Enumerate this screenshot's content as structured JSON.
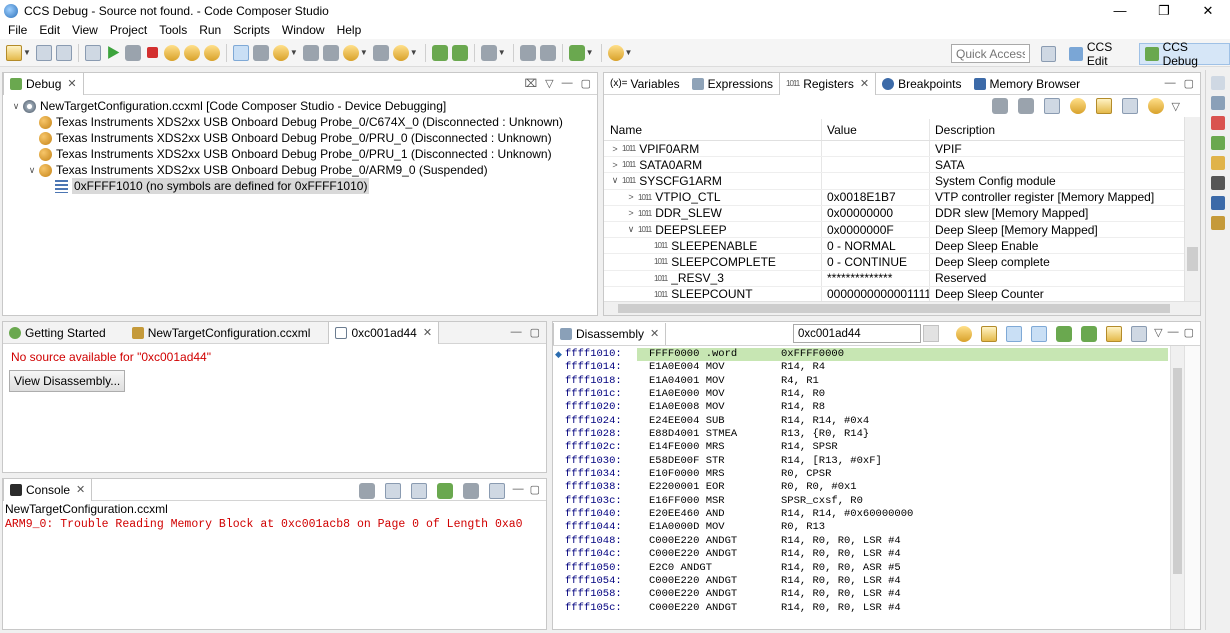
{
  "window": {
    "title": "CCS Debug - Source not found. - Code Composer Studio",
    "minimize": "—",
    "maximize": "❐",
    "close": "✕"
  },
  "menu": [
    "File",
    "Edit",
    "View",
    "Project",
    "Tools",
    "Run",
    "Scripts",
    "Window",
    "Help"
  ],
  "toolbar": {
    "quick_access_placeholder": "Quick Access",
    "perspectives": [
      "CCS Edit",
      "CCS Debug"
    ]
  },
  "debug_view": {
    "tab": "Debug",
    "tree": [
      {
        "level": 0,
        "toggle": "∨",
        "icon": "cfg",
        "text": "NewTargetConfiguration.ccxml [Code Composer Studio - Device Debugging]"
      },
      {
        "level": 1,
        "toggle": "",
        "icon": "probe",
        "text": "Texas Instruments XDS2xx USB Onboard Debug Probe_0/C674X_0 (Disconnected : Unknown)"
      },
      {
        "level": 1,
        "toggle": "",
        "icon": "probe",
        "text": "Texas Instruments XDS2xx USB Onboard Debug Probe_0/PRU_0 (Disconnected : Unknown)"
      },
      {
        "level": 1,
        "toggle": "",
        "icon": "probe",
        "text": "Texas Instruments XDS2xx USB Onboard Debug Probe_0/PRU_1 (Disconnected : Unknown)"
      },
      {
        "level": 1,
        "toggle": "∨",
        "icon": "probe",
        "text": "Texas Instruments XDS2xx USB Onboard Debug Probe_0/ARM9_0 (Suspended)"
      },
      {
        "level": 2,
        "toggle": "",
        "icon": "stack",
        "text": "0xFFFF1010  (no symbols are defined for 0xFFFF1010)",
        "selected": true
      }
    ]
  },
  "registers_view": {
    "tabs": [
      "Variables",
      "Expressions",
      "Registers",
      "Breakpoints",
      "Memory Browser"
    ],
    "columns": [
      "Name",
      "Value",
      "Description"
    ],
    "rows": [
      {
        "level": 0,
        "toggle": ">",
        "name": "VPIF0ARM",
        "value": "",
        "desc": "VPIF"
      },
      {
        "level": 0,
        "toggle": ">",
        "name": "SATA0ARM",
        "value": "",
        "desc": "SATA"
      },
      {
        "level": 0,
        "toggle": "∨",
        "name": "SYSCFG1ARM",
        "value": "",
        "desc": "System Config module"
      },
      {
        "level": 1,
        "toggle": ">",
        "name": "VTPIO_CTL",
        "value": "0x0018E1B7",
        "desc": "VTP controller register [Memory Mapped]"
      },
      {
        "level": 1,
        "toggle": ">",
        "name": "DDR_SLEW",
        "value": "0x00000000",
        "desc": "DDR slew [Memory Mapped]"
      },
      {
        "level": 1,
        "toggle": "∨",
        "name": "DEEPSLEEP",
        "value": "0x0000000F",
        "desc": "Deep Sleep [Memory Mapped]"
      },
      {
        "level": 2,
        "toggle": "",
        "name": "SLEEPENABLE",
        "value": "0 - NORMAL",
        "desc": "Deep Sleep Enable"
      },
      {
        "level": 2,
        "toggle": "",
        "name": "SLEEPCOMPLETE",
        "value": "0 - CONTINUE",
        "desc": "Deep Sleep complete"
      },
      {
        "level": 2,
        "toggle": "",
        "name": "_RESV_3",
        "value": "**************",
        "desc": "Reserved"
      },
      {
        "level": 2,
        "toggle": "",
        "name": "SLEEPCOUNT",
        "value": "0000000000001111",
        "desc": "Deep Sleep Counter"
      }
    ]
  },
  "editor": {
    "tabs": [
      "Getting Started",
      "NewTargetConfiguration.ccxml",
      "0xc001ad44"
    ],
    "message": "No source available for \"0xc001ad44\"",
    "button": "View Disassembly..."
  },
  "console": {
    "tab": "Console",
    "subtitle": "NewTargetConfiguration.ccxml",
    "error": "ARM9_0: Trouble Reading Memory Block at 0xc001acb8 on Page 0 of Length 0xa0"
  },
  "disassembly": {
    "tab": "Disassembly",
    "address_input": "0xc001ad44",
    "rows": [
      {
        "addr": "ffff1010:",
        "op": "FFFF0000 .word",
        "arg": "0xFFFF0000",
        "current": true
      },
      {
        "addr": "ffff1014:",
        "op": "E1A0E004 MOV",
        "arg": "R14, R4"
      },
      {
        "addr": "ffff1018:",
        "op": "E1A04001 MOV",
        "arg": "R4, R1"
      },
      {
        "addr": "ffff101c:",
        "op": "E1A0E000 MOV",
        "arg": "R14, R0"
      },
      {
        "addr": "ffff1020:",
        "op": "E1A0E008 MOV",
        "arg": "R14, R8"
      },
      {
        "addr": "ffff1024:",
        "op": "E24EE004 SUB",
        "arg": "R14, R14, #0x4"
      },
      {
        "addr": "ffff1028:",
        "op": "E88D4001 STMEA",
        "arg": "R13, {R0, R14}"
      },
      {
        "addr": "ffff102c:",
        "op": "E14FE000 MRS",
        "arg": "R14, SPSR"
      },
      {
        "addr": "ffff1030:",
        "op": "E58DE00F STR",
        "arg": "R14, [R13, #0xF]"
      },
      {
        "addr": "ffff1034:",
        "op": "E10F0000 MRS",
        "arg": "R0, CPSR"
      },
      {
        "addr": "ffff1038:",
        "op": "E2200001 EOR",
        "arg": "R0, R0, #0x1"
      },
      {
        "addr": "ffff103c:",
        "op": "E16FF000 MSR",
        "arg": "SPSR_cxsf, R0"
      },
      {
        "addr": "ffff1040:",
        "op": "E20EE460 AND",
        "arg": "R14, R14, #0x60000000"
      },
      {
        "addr": "ffff1044:",
        "op": "E1A0000D MOV",
        "arg": "R0, R13"
      },
      {
        "addr": "ffff1048:",
        "op": "C000E220 ANDGT",
        "arg": "R14, R0, R0, LSR #4"
      },
      {
        "addr": "ffff104c:",
        "op": "C000E220 ANDGT",
        "arg": "R14, R0, R0, LSR #4"
      },
      {
        "addr": "ffff1050:",
        "op": "E2C0 ANDGT",
        "arg": "R14, R0, R0, ASR #5"
      },
      {
        "addr": "ffff1054:",
        "op": "C000E220 ANDGT",
        "arg": "R14, R0, R0, LSR #4"
      },
      {
        "addr": "ffff1058:",
        "op": "C000E220 ANDGT",
        "arg": "R14, R0, R0, LSR #4"
      },
      {
        "addr": "ffff105c:",
        "op": "C000E220 ANDGT",
        "arg": "R14, R0, R0, LSR #4"
      }
    ]
  },
  "colors": {
    "error": "#d00000",
    "current_line": "#c7e6b3",
    "address": "#00007f"
  }
}
